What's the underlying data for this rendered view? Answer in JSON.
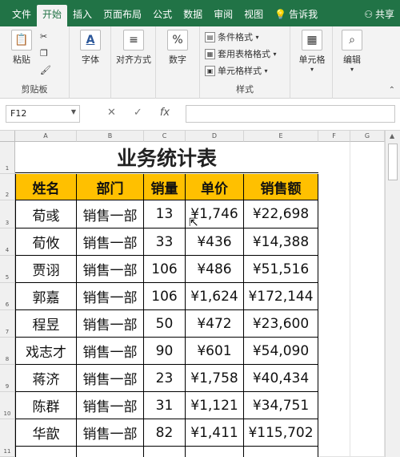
{
  "ribbon_tabs": [
    {
      "label": "文件"
    },
    {
      "label": "开始"
    },
    {
      "label": "插入"
    },
    {
      "label": "页面布局"
    },
    {
      "label": "公式"
    },
    {
      "label": "数据"
    },
    {
      "label": "审阅"
    },
    {
      "label": "视图"
    },
    {
      "label": "告诉我"
    },
    {
      "label": "共享"
    }
  ],
  "ribbon": {
    "paste_label": "粘贴",
    "clipboard_group": "剪贴板",
    "font_label": "字体",
    "align_label": "对齐方式",
    "number_label": "数字",
    "conditional_format": "条件格式",
    "table_format": "套用表格格式",
    "cell_style": "单元格样式",
    "style_group": "样式",
    "cells_label": "单元格",
    "edit_label": "编辑",
    "font_icon": "A",
    "number_icon": "%"
  },
  "formula_bar": {
    "name_box": "F12",
    "cancel_icon": "✕",
    "enter_icon": "✓",
    "fx_icon": "fx",
    "formula_value": ""
  },
  "columns": [
    "A",
    "B",
    "C",
    "D",
    "E",
    "F",
    "G"
  ],
  "rows": [
    "1",
    "2",
    "3",
    "4",
    "5",
    "6",
    "7",
    "8",
    "9",
    "10",
    "11"
  ],
  "sheet": {
    "title": "业务统计表",
    "headers": [
      "姓名",
      "部门",
      "销量",
      "单价",
      "销售额"
    ],
    "data": [
      [
        "荀彧",
        "销售一部",
        "13",
        "¥1,746",
        "¥22,698"
      ],
      [
        "荀攸",
        "销售一部",
        "33",
        "¥436",
        "¥14,388"
      ],
      [
        "贾诩",
        "销售一部",
        "106",
        "¥486",
        "¥51,516"
      ],
      [
        "郭嘉",
        "销售一部",
        "106",
        "¥1,624",
        "¥172,144"
      ],
      [
        "程昱",
        "销售一部",
        "50",
        "¥472",
        "¥23,600"
      ],
      [
        "戏志才",
        "销售一部",
        "90",
        "¥601",
        "¥54,090"
      ],
      [
        "蒋济",
        "销售一部",
        "23",
        "¥1,758",
        "¥40,434"
      ],
      [
        "陈群",
        "销售一部",
        "31",
        "¥1,121",
        "¥34,751"
      ],
      [
        "华歆",
        "销售一部",
        "82",
        "¥1,411",
        "¥115,702"
      ]
    ]
  },
  "colors": {
    "accent": "#217346",
    "header_fill": "#ffc000"
  }
}
